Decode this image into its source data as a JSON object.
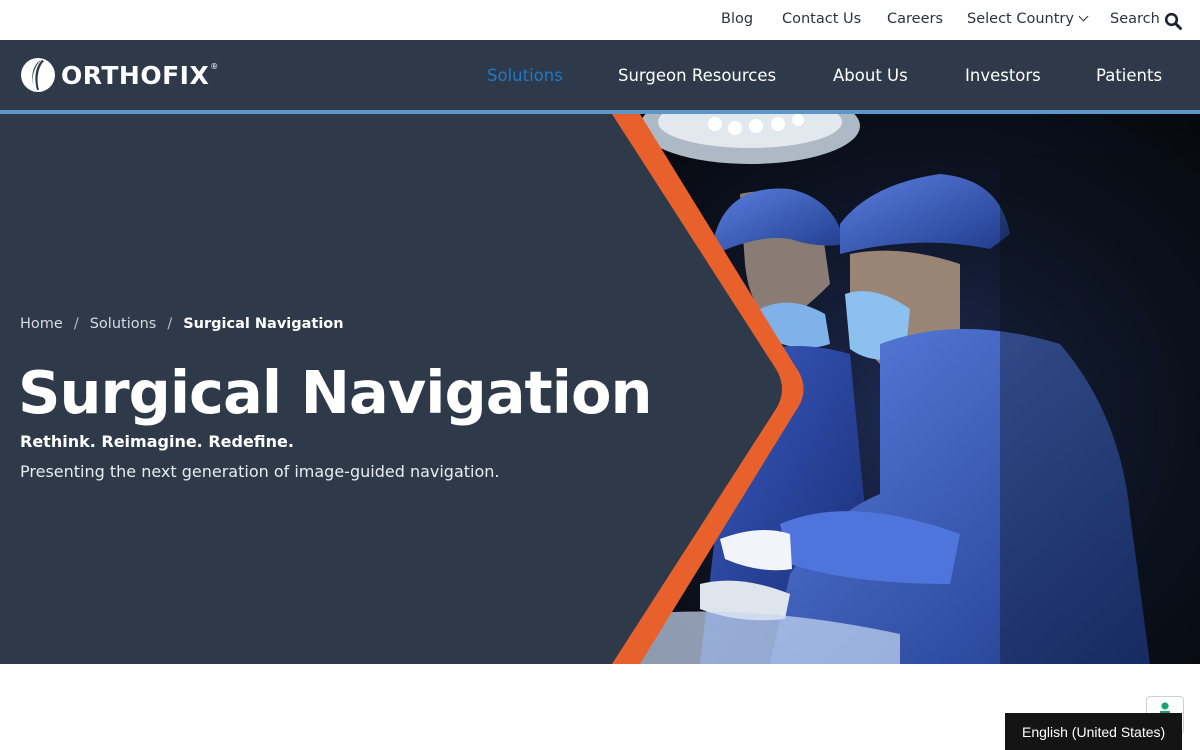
{
  "utility_nav": {
    "blog": "Blog",
    "contact": "Contact Us",
    "careers": "Careers",
    "country": "Select Country",
    "search": "Search"
  },
  "brand": {
    "name": "ORTHOFIX",
    "registered_mark": "®"
  },
  "main_nav": {
    "items": [
      "Solutions",
      "Surgeon Resources",
      "About Us",
      "Investors",
      "Patients"
    ],
    "active": "Solutions"
  },
  "breadcrumb": {
    "items": [
      "Home",
      "Solutions",
      "Surgical Navigation"
    ],
    "separator": "/"
  },
  "hero": {
    "title": "Surgical Navigation",
    "tagline": "Rethink. Reimagine. Redefine.",
    "description": "Presenting the next generation of image-guided navigation."
  },
  "language_widget": {
    "label": "English (United States)"
  },
  "colors": {
    "navy": "#2e3a4a",
    "accent_blue": "#1e78c8",
    "nav_underline": "#5b98c9",
    "orange": "#e8612c",
    "widget_green": "#1aa36f"
  },
  "icons": [
    "chevron-down-icon",
    "search-icon",
    "orthofix-logo-icon",
    "accessibility-icon"
  ]
}
